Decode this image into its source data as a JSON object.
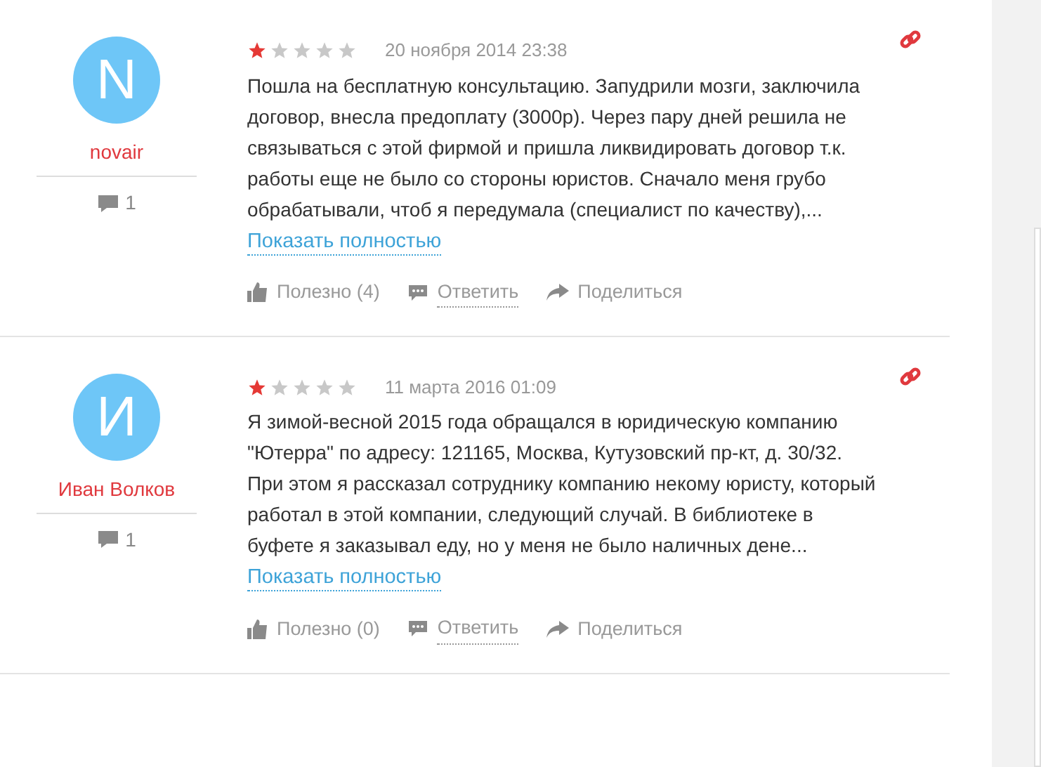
{
  "reviews": [
    {
      "avatar_letter": "N",
      "author": "novair",
      "comments": "1",
      "stars": 1,
      "date": "20 ноября 2014 23:38",
      "text": "Пошла на бесплатную консультацию. Запудрили мозги, заключила договор, внесла предоплату (3000р). Через пару дней решила не связываться с этой фирмой и пришла ликвидировать договор т.к. работы еще не было со стороны юристов. Сначало меня грубо обрабатывали, чтоб я передумала (специалист по качеству),...",
      "more": "Показать полностью",
      "useful": "Полезно (4)",
      "reply": "Ответить",
      "share": "Поделиться"
    },
    {
      "avatar_letter": "И",
      "author": "Иван Волков",
      "comments": "1",
      "stars": 1,
      "date": "11 марта 2016 01:09",
      "text": "Я зимой-весной 2015 года обращался в юридическую компанию \"Ютерра\" по адресу: 121165, Москва, Кутузовский пр-кт, д. 30/32. При этом я рассказал сотруднику компанию некому юристу, который работал в этой компании, следующий случай. В библиотеке в буфете я заказывал еду, но у меня не было наличных дене...",
      "more": "Показать полностью",
      "useful": "Полезно (0)",
      "reply": "Ответить",
      "share": "Поделиться"
    }
  ]
}
